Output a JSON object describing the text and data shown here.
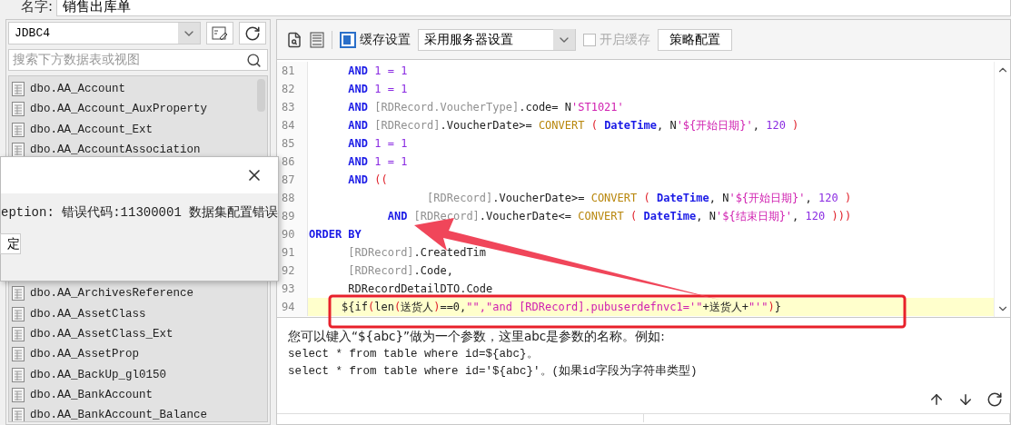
{
  "name_field": {
    "label": "名字:",
    "value": "销售出库单"
  },
  "datasource": {
    "connection": "JDBC4",
    "search": {
      "placeholder": "搜索下方数据表或视图"
    },
    "tables": [
      "dbo.AA_Account",
      "dbo.AA_Account_AuxProperty",
      "dbo.AA_Account_Ext",
      "dbo.AA_AccountAssociation",
      "dbo.AA_ArchivesReference",
      "dbo.AA_AssetClass",
      "dbo.AA_AssetClass_Ext",
      "dbo.AA_AssetProp",
      "dbo.AA_BackUp_gl0150",
      "dbo.AA_BankAccount",
      "dbo.AA_BankAccount_Balance"
    ]
  },
  "toolbar": {
    "cache_label": "缓存设置",
    "cache_mode": "采用服务器设置",
    "enable_cache": {
      "label": "开启缓存",
      "checked": false,
      "disabled": true
    },
    "strategy_button": "策略配置"
  },
  "editor": {
    "lines": [
      {
        "number": "81",
        "highlighted": false,
        "tokens": [
          {
            "kind": "keyword",
            "text": "      AND"
          },
          {
            "kind": "number",
            "text": " 1 = 1"
          }
        ]
      },
      {
        "number": "82",
        "highlighted": false,
        "tokens": [
          {
            "kind": "keyword",
            "text": "      AND"
          },
          {
            "kind": "number",
            "text": " 1 = 1"
          }
        ]
      },
      {
        "number": "83",
        "highlighted": false,
        "tokens": [
          {
            "kind": "keyword",
            "text": "      AND "
          },
          {
            "kind": "name",
            "text": "[RDRecord.VoucherType]"
          },
          {
            "kind": "plain",
            "text": ".code= N"
          },
          {
            "kind": "string",
            "text": "'ST1021'"
          }
        ]
      },
      {
        "number": "84",
        "highlighted": false,
        "tokens": [
          {
            "kind": "keyword",
            "text": "      AND "
          },
          {
            "kind": "name",
            "text": "[RDRecord]"
          },
          {
            "kind": "plain",
            "text": ".VoucherDate>= "
          },
          {
            "kind": "function",
            "text": "CONVERT"
          },
          {
            "kind": "paren",
            "text": " ( "
          },
          {
            "kind": "keyword",
            "text": "DateTime"
          },
          {
            "kind": "plain",
            "text": ", N"
          },
          {
            "kind": "string",
            "text": "'${开始日期}'"
          },
          {
            "kind": "plain",
            "text": ", "
          },
          {
            "kind": "number",
            "text": "120"
          },
          {
            "kind": "paren",
            "text": " )"
          }
        ]
      },
      {
        "number": "85",
        "highlighted": false,
        "tokens": [
          {
            "kind": "keyword",
            "text": "      AND"
          },
          {
            "kind": "number",
            "text": " 1 = 1"
          }
        ]
      },
      {
        "number": "86",
        "highlighted": false,
        "tokens": [
          {
            "kind": "keyword",
            "text": "      AND"
          },
          {
            "kind": "number",
            "text": " 1 = 1"
          }
        ]
      },
      {
        "number": "87",
        "highlighted": false,
        "tokens": [
          {
            "kind": "keyword",
            "text": "      AND "
          },
          {
            "kind": "paren",
            "text": "(("
          }
        ]
      },
      {
        "number": "88",
        "highlighted": false,
        "tokens": [
          {
            "kind": "name",
            "text": "                  [RDRecord]"
          },
          {
            "kind": "plain",
            "text": ".VoucherDate>= "
          },
          {
            "kind": "function",
            "text": "CONVERT"
          },
          {
            "kind": "paren",
            "text": " ( "
          },
          {
            "kind": "keyword",
            "text": "DateTime"
          },
          {
            "kind": "plain",
            "text": ", N"
          },
          {
            "kind": "string",
            "text": "'${开始日期}'"
          },
          {
            "kind": "plain",
            "text": ", "
          },
          {
            "kind": "number",
            "text": "120"
          },
          {
            "kind": "paren",
            "text": " )"
          }
        ]
      },
      {
        "number": "89",
        "highlighted": false,
        "tokens": [
          {
            "kind": "keyword",
            "text": "            AND "
          },
          {
            "kind": "name",
            "text": "[RDRecord]"
          },
          {
            "kind": "plain",
            "text": ".VoucherDate<= "
          },
          {
            "kind": "function",
            "text": "CONVERT"
          },
          {
            "kind": "paren",
            "text": " ( "
          },
          {
            "kind": "keyword",
            "text": "DateTime"
          },
          {
            "kind": "plain",
            "text": ", N"
          },
          {
            "kind": "string",
            "text": "'${结束日期}'"
          },
          {
            "kind": "plain",
            "text": ", "
          },
          {
            "kind": "number",
            "text": "120"
          },
          {
            "kind": "paren",
            "text": " )))"
          }
        ]
      },
      {
        "number": "90",
        "highlighted": false,
        "tokens": [
          {
            "kind": "keyword",
            "text": "ORDER BY"
          }
        ]
      },
      {
        "number": "91",
        "highlighted": false,
        "tokens": [
          {
            "kind": "name",
            "text": "      [RDRecord]"
          },
          {
            "kind": "plain",
            "text": ".CreatedTim"
          }
        ]
      },
      {
        "number": "92",
        "highlighted": false,
        "tokens": [
          {
            "kind": "name",
            "text": "      [RDRecord]"
          },
          {
            "kind": "plain",
            "text": ".Code,"
          }
        ]
      },
      {
        "number": "93",
        "highlighted": false,
        "tokens": [
          {
            "kind": "plain",
            "text": "      RDRecordDetailDTO.Code"
          }
        ]
      },
      {
        "number": "94",
        "highlighted": true,
        "tokens": [
          {
            "kind": "plain",
            "text": "     ${if"
          },
          {
            "kind": "paren",
            "text": "("
          },
          {
            "kind": "plain",
            "text": "len"
          },
          {
            "kind": "paren",
            "text": "("
          },
          {
            "kind": "plain",
            "text": "送货人"
          },
          {
            "kind": "paren",
            "text": ")"
          },
          {
            "kind": "plain",
            "text": "==0,"
          },
          {
            "kind": "string",
            "text": "\"\",\"and [RDRecord].pubuserdefnvc1='\""
          },
          {
            "kind": "plain",
            "text": "+送货人+"
          },
          {
            "kind": "string",
            "text": "\"'\""
          },
          {
            "kind": "paren",
            "text": ")"
          },
          {
            "kind": "plain",
            "text": "}"
          }
        ]
      }
    ]
  },
  "help": {
    "lines": [
      "您可以键入“${abc}”做为一个参数，这里abc是参数的名称。例如:",
      "select * from table where id=${abc}。",
      "select * from table where id='${abc}'。(如果id字段为字符串类型)"
    ]
  },
  "dialog": {
    "message": "eption: 错误代码:11300001 数据集配置错误",
    "button": "定"
  }
}
